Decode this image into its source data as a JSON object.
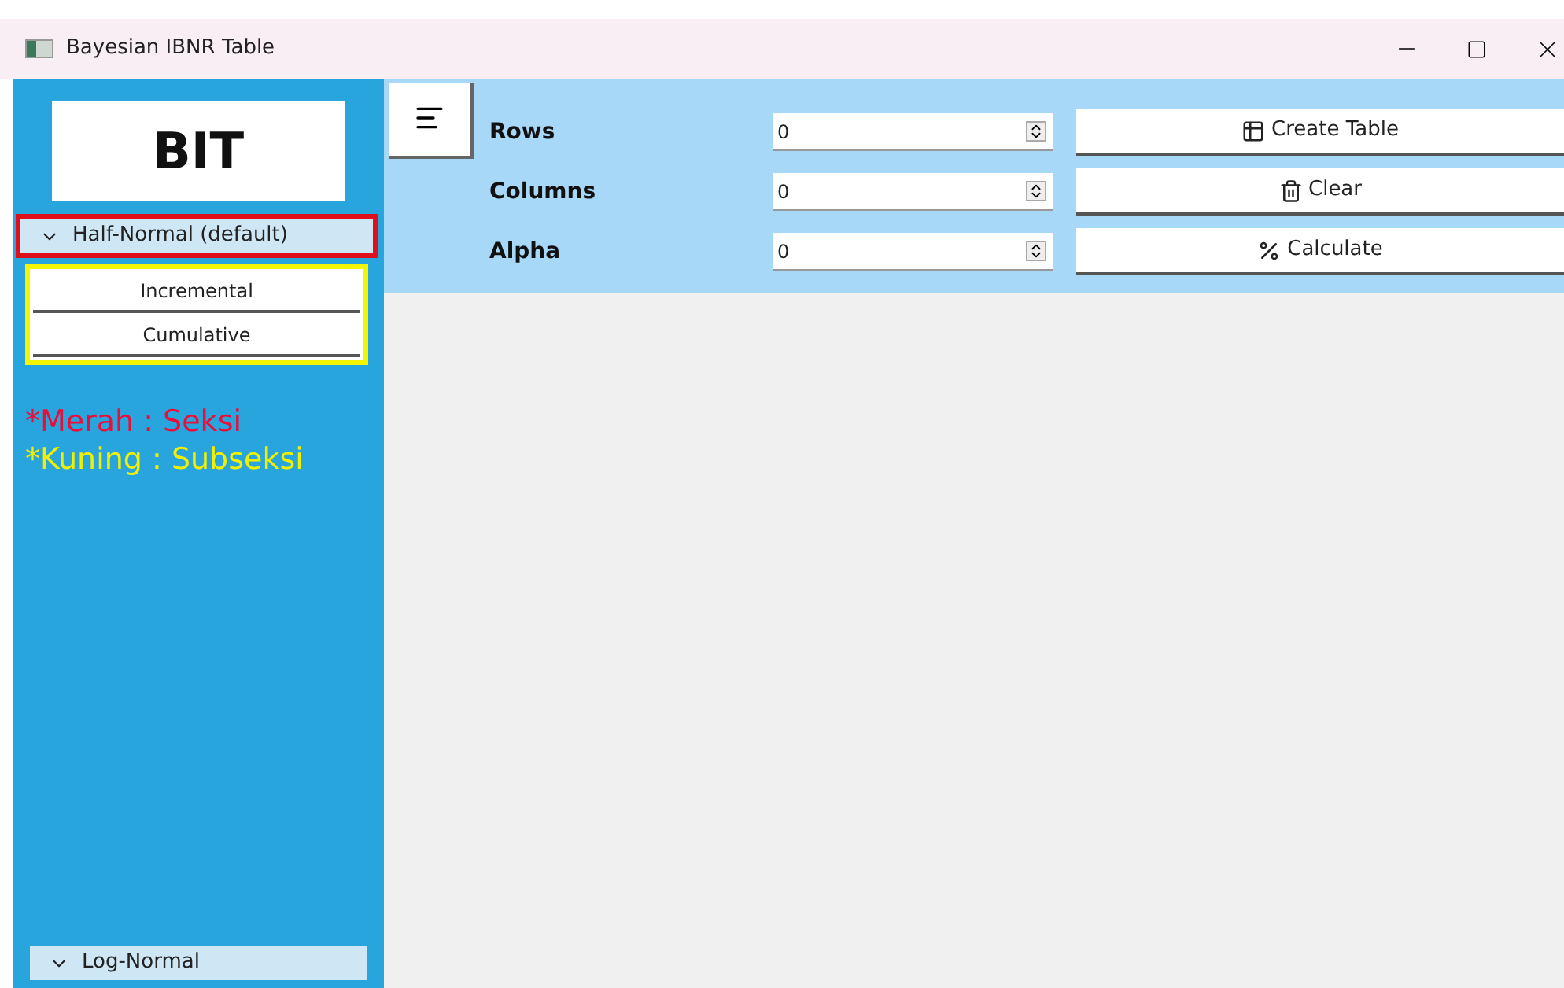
{
  "window": {
    "title": "Bayesian IBNR Table"
  },
  "sidebar": {
    "logo": "BIT",
    "sections": [
      {
        "label": "Half-Normal (default)",
        "expanded": true,
        "color": "#e0101a",
        "subsection": {
          "color": "#f5f500",
          "items": [
            "Incremental",
            "Cumulative"
          ]
        }
      },
      {
        "label": "Log-Normal",
        "expanded": true
      }
    ],
    "legend": [
      {
        "text": "*Merah : Seksi",
        "color": "#e8103a"
      },
      {
        "text": "*Kuning : Subseksi",
        "color": "#f0f000"
      }
    ]
  },
  "form": {
    "fields": [
      {
        "label": "Rows",
        "value": "0"
      },
      {
        "label": "Columns",
        "value": "0"
      },
      {
        "label": "Alpha",
        "value": "0"
      }
    ],
    "buttons": [
      {
        "label": "Create Table",
        "kind": "table"
      },
      {
        "label": "Clear",
        "kind": "trash"
      },
      {
        "label": "Calculate",
        "kind": "percent"
      }
    ]
  }
}
